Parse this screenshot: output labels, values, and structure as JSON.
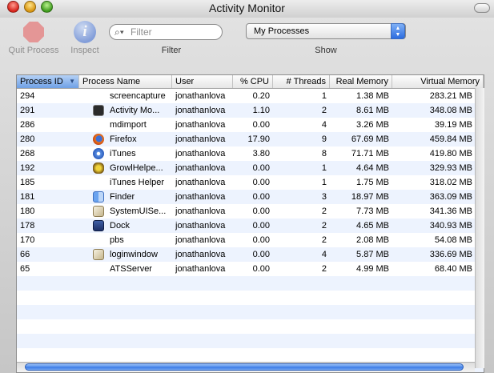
{
  "window": {
    "title": "Activity Monitor"
  },
  "toolbar": {
    "quit_label": "Quit Process",
    "inspect_label": "Inspect",
    "filter_placeholder": "Filter",
    "filter_value": "",
    "filter_label": "Filter",
    "show_value": "My Processes",
    "show_label": "Show"
  },
  "table": {
    "columns": [
      "Process ID",
      "Process Name",
      "User",
      "% CPU",
      "# Threads",
      "Real Memory",
      "Virtual Memory"
    ],
    "sorted_column": "Process ID",
    "rows": [
      {
        "pid": "294",
        "name": "screencapture",
        "icon": "",
        "user": "jonathanlova",
        "cpu": "0.20",
        "threads": "1",
        "real": "1.38 MB",
        "virtual": "283.21 MB"
      },
      {
        "pid": "291",
        "name": "Activity Mo...",
        "icon": "activity-monitor-icon",
        "user": "jonathanlova",
        "cpu": "1.10",
        "threads": "2",
        "real": "8.61 MB",
        "virtual": "348.08 MB"
      },
      {
        "pid": "286",
        "name": "mdimport",
        "icon": "",
        "user": "jonathanlova",
        "cpu": "0.00",
        "threads": "4",
        "real": "3.26 MB",
        "virtual": "39.19 MB"
      },
      {
        "pid": "280",
        "name": "Firefox",
        "icon": "firefox-icon",
        "user": "jonathanlova",
        "cpu": "17.90",
        "threads": "9",
        "real": "67.69 MB",
        "virtual": "459.84 MB"
      },
      {
        "pid": "268",
        "name": "iTunes",
        "icon": "itunes-icon",
        "user": "jonathanlova",
        "cpu": "3.80",
        "threads": "8",
        "real": "71.71 MB",
        "virtual": "419.80 MB"
      },
      {
        "pid": "192",
        "name": "GrowlHelpe...",
        "icon": "growl-icon",
        "user": "jonathanlova",
        "cpu": "0.00",
        "threads": "1",
        "real": "4.64 MB",
        "virtual": "329.93 MB"
      },
      {
        "pid": "185",
        "name": "iTunes Helper",
        "icon": "",
        "user": "jonathanlova",
        "cpu": "0.00",
        "threads": "1",
        "real": "1.75 MB",
        "virtual": "318.02 MB"
      },
      {
        "pid": "181",
        "name": "Finder",
        "icon": "finder-icon",
        "user": "jonathanlova",
        "cpu": "0.00",
        "threads": "3",
        "real": "18.97 MB",
        "virtual": "363.09 MB"
      },
      {
        "pid": "180",
        "name": "SystemUISe...",
        "icon": "system-ui-server-icon",
        "user": "jonathanlova",
        "cpu": "0.00",
        "threads": "2",
        "real": "7.73 MB",
        "virtual": "341.36 MB"
      },
      {
        "pid": "178",
        "name": "Dock",
        "icon": "dock-icon",
        "user": "jonathanlova",
        "cpu": "0.00",
        "threads": "2",
        "real": "4.65 MB",
        "virtual": "340.93 MB"
      },
      {
        "pid": "170",
        "name": "pbs",
        "icon": "",
        "user": "jonathanlova",
        "cpu": "0.00",
        "threads": "2",
        "real": "2.08 MB",
        "virtual": "54.08 MB"
      },
      {
        "pid": "66",
        "name": "loginwindow",
        "icon": "loginwindow-icon",
        "user": "jonathanlova",
        "cpu": "0.00",
        "threads": "4",
        "real": "5.87 MB",
        "virtual": "336.69 MB"
      },
      {
        "pid": "65",
        "name": "ATSServer",
        "icon": "",
        "user": "jonathanlova",
        "cpu": "0.00",
        "threads": "2",
        "real": "4.99 MB",
        "virtual": "68.40 MB"
      }
    ],
    "empty_rows": 7
  }
}
